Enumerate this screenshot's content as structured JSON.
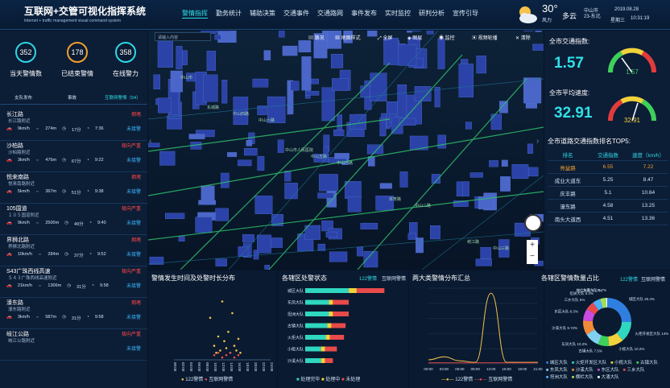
{
  "header": {
    "title": "互联网+交管可视化指挥系统",
    "subtitle": "Internet + traffic management visual command system",
    "nav": [
      "警情指挥",
      "勤务统计",
      "辅助决策",
      "交通事件",
      "交通路网",
      "事件发布",
      "实时监控",
      "研判分析",
      "宣传引导"
    ],
    "weather": {
      "temp": "30°",
      "wind": "风力",
      "desc": "多云",
      "city": "中山市",
      "city2": "23-东北",
      "date": "2019.08.28",
      "weekday": "星期三",
      "time": "10:31:19"
    }
  },
  "stats": [
    {
      "value": "352",
      "label": "当天警情数",
      "color": "#2fd6e6"
    },
    {
      "value": "178",
      "label": "已结束警情",
      "color": "#f0a030"
    },
    {
      "value": "358",
      "label": "在线警力",
      "color": "#2fd6e6"
    }
  ],
  "tabs": [
    "支队发布",
    "事故",
    "互联网警情（54）"
  ],
  "incidents": [
    {
      "name": "长江路",
      "sub": "长江路附近",
      "speed": "9km/h",
      "dist": "274m",
      "delay": "17分",
      "time": "7:36",
      "level": "拥堵",
      "status": "未接警"
    },
    {
      "name": "沙柏路",
      "sub": "沙柏路附近",
      "speed": "3km/h",
      "dist": "476m",
      "delay": "67分",
      "time": "9:22",
      "level": "极向严重",
      "status": "未接警"
    },
    {
      "name": "悦来南路",
      "sub": "悦来南路附近",
      "speed": "5km/h",
      "dist": "367m",
      "delay": "51分",
      "time": "9:38",
      "level": "拥堵",
      "status": "未接警"
    },
    {
      "name": "105国道",
      "sub": "１０５国道附近",
      "speed": "9km/h",
      "dist": "2500m",
      "delay": "49分",
      "time": "9:40",
      "level": "极向严重",
      "status": "未接警"
    },
    {
      "name": "界狮北路",
      "sub": "界狮北路附近",
      "speed": "10km/h",
      "dist": "284m",
      "delay": "37分",
      "time": "9:52",
      "level": "拥堵",
      "status": "未接警"
    },
    {
      "name": "S43广珠西线高速",
      "sub": "Ｓ４３广珠西线高速附近",
      "speed": "21km/h",
      "dist": "1306m",
      "delay": "31分",
      "time": "9:58",
      "level": "极向严重",
      "status": "未接警"
    },
    {
      "name": "濠东路",
      "sub": "濠东路附近",
      "speed": "3km/h",
      "dist": "587m",
      "delay": "31分",
      "time": "9:58",
      "level": "拥堵",
      "status": "未接警"
    },
    {
      "name": "岐江公路",
      "sub": "岐江公路附近",
      "speed": "",
      "dist": "",
      "delay": "",
      "time": "",
      "level": "极向严重",
      "status": "未接警"
    }
  ],
  "map": {
    "search_placeholder": "请输入内容",
    "tools": [
      "路况",
      "地图样式",
      "全屏",
      "图层",
      "监控",
      "视频轮播",
      "清除"
    ],
    "labels": [
      "中山市",
      "中山六路",
      "中山一路",
      "中山二路",
      "中山三路",
      "中山四路",
      "中山五路",
      "体育路",
      "岐江路",
      "东城路",
      "中山市人民医院"
    ]
  },
  "right": {
    "index_label": "全市交通指数:",
    "index_value": "1.57",
    "gauge1": "1.57",
    "speed_label": "全市平均速度:",
    "speed_value": "32.91",
    "gauge2": "32.91",
    "rank_title": "全市道路交通指数排名TOP5:",
    "rank_headers": [
      "排名",
      "交通指数",
      "速度（km/h）"
    ],
    "rank_rows": [
      [
        "亮益路",
        "6.55",
        "7.22"
      ],
      [
        "成业大道东",
        "5.25",
        "8.47"
      ],
      [
        "庆丰路",
        "5.1",
        "10.64"
      ],
      [
        "濠东路",
        "4.58",
        "13.25"
      ],
      [
        "南头大道西",
        "4.51",
        "13.36"
      ]
    ]
  },
  "bottom": {
    "scatter_title": "警情发生时间及处警时长分布",
    "scatter_legend": [
      "122警情",
      "互联网警情"
    ],
    "scatter_x": [
      "00:00",
      "02:00",
      "04:00",
      "06:00",
      "08:00",
      "10:00",
      "12:00",
      "14:00",
      "16:00",
      "18:00",
      "20:00",
      "22:00",
      "24:00"
    ],
    "bar_title": "各辖区处警状态",
    "bar_tags": [
      "122警情",
      "互联网警情"
    ],
    "bar_legend": [
      "处理完毕",
      "处理中",
      "未处理"
    ],
    "line_title": "两大类警情分布汇总",
    "line_legend": [
      "122警情",
      "互联网警情"
    ],
    "line_x": [
      "00:00",
      "03:00",
      "06:00",
      "09:00",
      "12:00",
      "15:00",
      "18:00",
      "21:00"
    ],
    "pie_title": "各辖区警情数量占比",
    "pie_tags": [
      "122警情",
      "互联网警情"
    ],
    "pie_labels": [
      "城区大队",
      "火炬开发区大队",
      "小榄大队",
      "古镇大队",
      "东凤大队",
      "沙溪大队",
      "东区大队",
      "三乡大队",
      "坦洲大队",
      "横栏大队",
      "大涌大队"
    ],
    "pie_pct": [
      "",
      "",
      "",
      "",
      "",
      "",
      "",
      "",
      "",
      "",
      ""
    ]
  },
  "chart_data": [
    {
      "type": "bar",
      "title": "各辖区处警状态",
      "categories": [
        "城区大队",
        "东凤大队",
        "坦洲大队",
        "古镇大队",
        "火炬大队",
        "小榄大队",
        "沙溪大队"
      ],
      "series": [
        {
          "name": "处理完毕",
          "values": [
            55,
            30,
            30,
            28,
            26,
            20,
            20
          ]
        },
        {
          "name": "处理中",
          "values": [
            10,
            5,
            5,
            5,
            5,
            5,
            5
          ]
        },
        {
          "name": "未处理",
          "values": [
            35,
            20,
            20,
            18,
            18,
            15,
            10
          ]
        }
      ],
      "xlim": [
        0,
        120
      ]
    },
    {
      "type": "line",
      "title": "两大类警情分布汇总",
      "x": [
        "00:00",
        "03:00",
        "06:00",
        "09:00",
        "12:00",
        "15:00",
        "18:00",
        "21:00"
      ],
      "series": [
        {
          "name": "122警情",
          "values": [
            8,
            14,
            6,
            3,
            140,
            3,
            3,
            3
          ]
        },
        {
          "name": "互联网警情",
          "values": [
            2,
            2,
            2,
            2,
            2,
            2,
            2,
            2
          ]
        }
      ]
    },
    {
      "type": "pie",
      "title": "各辖区警情数量占比",
      "labels": [
        "城区大队",
        "火炬开发区大队",
        "小榄大队",
        "古镇大队",
        "东凤大队",
        "沙溪大队",
        "东区大队",
        "三乡大队",
        "坦洲大队",
        "横栏大队",
        "大涌大队"
      ],
      "values": [
        25.4,
        14.0,
        10.2,
        7.5,
        10.2,
        9.72,
        8.3,
        6.0,
        5.3,
        4.17,
        0.7
      ]
    },
    {
      "type": "scatter",
      "title": "警情发生时间及处警时长分布",
      "series": [
        {
          "name": "122警情",
          "points": [
            [
              9,
              18
            ],
            [
              10,
              6
            ],
            [
              10.5,
              3
            ],
            [
              11,
              10
            ],
            [
              11.5,
              4
            ],
            [
              12,
              25
            ],
            [
              12.5,
              8
            ],
            [
              13,
              5
            ],
            [
              13.5,
              12
            ],
            [
              14,
              3
            ],
            [
              14.5,
              20
            ],
            [
              15,
              6
            ],
            [
              15.5,
              4
            ],
            [
              16,
              9
            ],
            [
              16.5,
              3
            ]
          ]
        },
        {
          "name": "互联网警情",
          "points": [
            [
              10,
              2
            ],
            [
              11,
              3
            ],
            [
              12,
              1
            ],
            [
              13,
              2
            ],
            [
              14,
              3
            ],
            [
              15,
              1
            ],
            [
              16,
              2
            ]
          ]
        }
      ]
    }
  ]
}
